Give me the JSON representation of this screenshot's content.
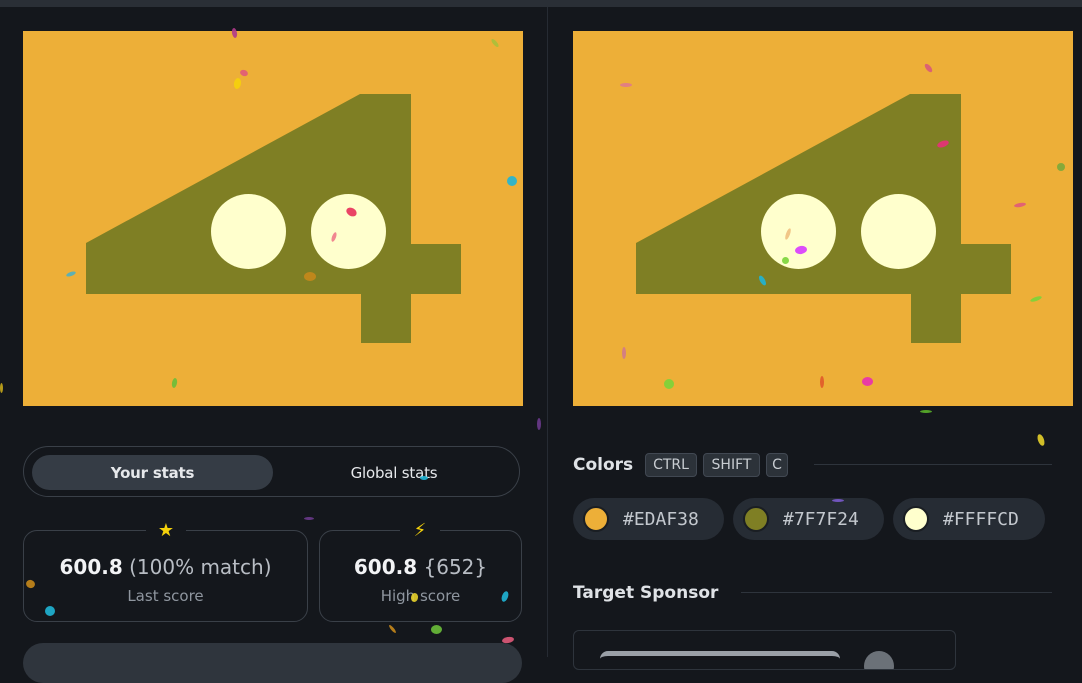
{
  "palette": {
    "background": "#EDAF38",
    "shape": "#7F7F24",
    "circles": "#FFFFCD"
  },
  "stats": {
    "tab_your": "Your stats",
    "tab_global": "Global stats",
    "last_score": {
      "icon": "star-icon",
      "value": "600.8",
      "detail": "(100% match)",
      "label": "Last score"
    },
    "high_score": {
      "icon": "lightning-icon",
      "value": "600.8",
      "detail": "{652}",
      "label": "High score"
    }
  },
  "colors_section": {
    "title": "Colors",
    "shortcut": [
      "CTRL",
      "SHIFT",
      "C"
    ],
    "swatches": [
      {
        "hex": "#EDAF38",
        "color": "#EDAF38"
      },
      {
        "hex": "#7F7F24",
        "color": "#7F7F24"
      },
      {
        "hex": "#FFFFCD",
        "color": "#FFFFCD"
      }
    ]
  },
  "sponsor_section": {
    "title": "Target Sponsor"
  }
}
